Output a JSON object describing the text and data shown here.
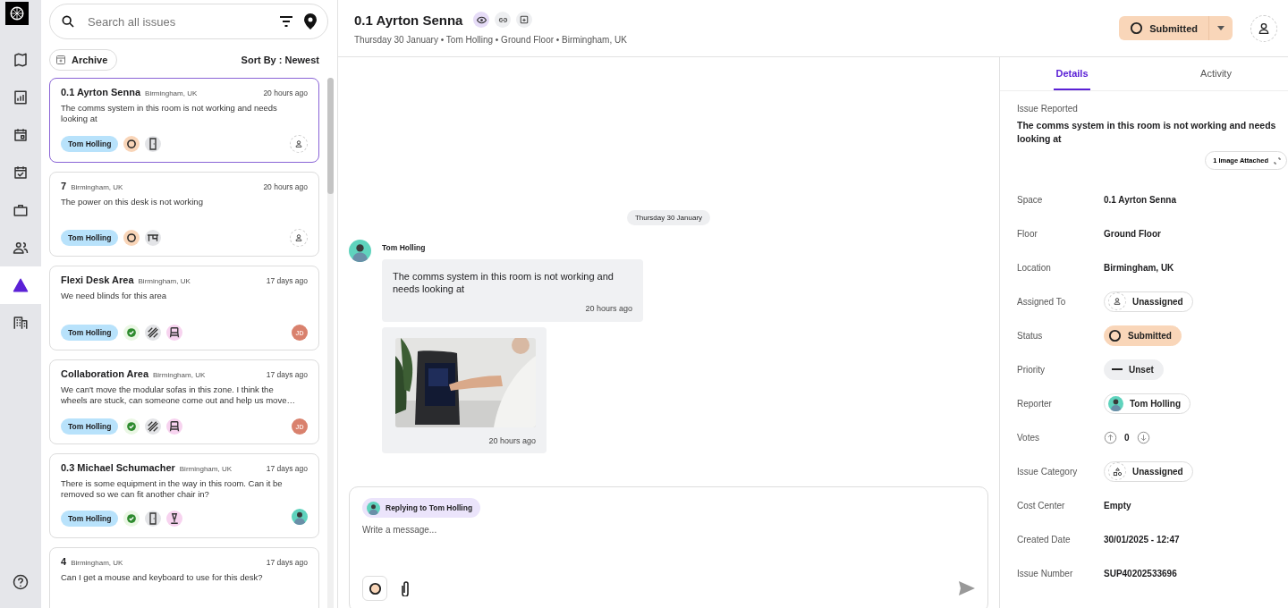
{
  "rail": {
    "items": [
      {
        "kind": "map",
        "selected": false
      },
      {
        "kind": "chart",
        "selected": false
      },
      {
        "kind": "calendar",
        "selected": false
      },
      {
        "kind": "calendar-check",
        "selected": false
      },
      {
        "kind": "briefcase",
        "selected": false
      },
      {
        "kind": "people",
        "selected": false
      },
      {
        "kind": "warning",
        "selected": true
      },
      {
        "kind": "building",
        "selected": false
      }
    ]
  },
  "search": {
    "placeholder": "Search all issues"
  },
  "archive_button": "Archive",
  "sort": "Sort By : Newest",
  "issues": [
    {
      "title": "0.1 Ayrton Senna",
      "location": "Birmingham, UK",
      "time": "20 hours ago",
      "description": "The comms system in this room is not working and needs looking at",
      "reporter": "Tom Holling",
      "status": {
        "kind": "submitted"
      },
      "categories": [
        {
          "kind": "door"
        }
      ],
      "assignee": {
        "kind": "unassigned"
      },
      "selected": true
    },
    {
      "title": "7",
      "location": "Birmingham, UK",
      "time": "20 hours ago",
      "description": "The power on this desk is not working",
      "reporter": "Tom Holling",
      "status": {
        "kind": "submitted"
      },
      "categories": [
        {
          "kind": "desk"
        }
      ],
      "assignee": {
        "kind": "unassigned"
      },
      "selected": false
    },
    {
      "title": "Flexi Desk Area",
      "location": "Birmingham, UK",
      "time": "17 days ago",
      "description": "We need blinds for this area",
      "reporter": "Tom Holling",
      "status": {
        "kind": "resolved"
      },
      "categories": [
        {
          "kind": "hatch"
        },
        {
          "kind": "chair"
        }
      ],
      "assignee": {
        "kind": "initials",
        "text": "JD"
      },
      "selected": false
    },
    {
      "title": "Collaboration Area",
      "location": "Birmingham, UK",
      "time": "17 days ago",
      "description": "We can't move the modular sofas in this zone. I think the wheels are stuck, can someone come out and help us move…",
      "reporter": "Tom Holling",
      "status": {
        "kind": "resolved"
      },
      "categories": [
        {
          "kind": "hatch"
        },
        {
          "kind": "chair"
        }
      ],
      "assignee": {
        "kind": "initials",
        "text": "JD"
      },
      "selected": false
    },
    {
      "title": "0.3 Michael Schumacher",
      "location": "Birmingham, UK",
      "time": "17 days ago",
      "description": "There is some equipment in the way in this room. Can it be removed so we can fit another chair in?",
      "reporter": "Tom Holling",
      "status": {
        "kind": "resolved"
      },
      "categories": [
        {
          "kind": "door"
        },
        {
          "kind": "lamp"
        }
      ],
      "assignee": {
        "kind": "avatar"
      },
      "selected": false
    },
    {
      "title": "4",
      "location": "Birmingham, UK",
      "time": "17 days ago",
      "description": "Can I get a mouse and keyboard to use for this desk?",
      "selected": false
    }
  ],
  "header": {
    "title": "0.1 Ayrton Senna",
    "subtitle": "Thursday 30 January • Tom Holling • Ground Floor • Birmingham, UK",
    "status_button": "Submitted"
  },
  "chat": {
    "date": "Thursday 30 January",
    "author": "Tom Holling",
    "messages": [
      {
        "kind": "text",
        "text": "The comms system in this room is not working and needs looking at",
        "time": "20 hours ago"
      },
      {
        "time": "20 hours ago"
      }
    ]
  },
  "composer": {
    "reply_to": "Replying to Tom Holling",
    "placeholder": "Write a message..."
  },
  "details": {
    "tabs": [
      {
        "label": "Details",
        "selected": true
      },
      {
        "label": "Activity",
        "selected": false
      }
    ],
    "issue_label": "Issue Reported",
    "issue_text": "The comms system in this room is not working and needs looking at",
    "attachment": "1 Image Attached",
    "fields": [
      {
        "label": "Space",
        "kind": "text",
        "value": "0.1 Ayrton Senna"
      },
      {
        "label": "Floor",
        "kind": "text",
        "value": "Ground Floor"
      },
      {
        "label": "Location",
        "kind": "text",
        "value": "Birmingham, UK"
      },
      {
        "label": "Assigned To",
        "kind": "user",
        "value": "Unassigned"
      },
      {
        "label": "Status",
        "kind": "status",
        "value": "Submitted"
      },
      {
        "label": "Priority",
        "kind": "priority",
        "value": "Unset"
      },
      {
        "label": "Reporter",
        "kind": "reporter",
        "value": "Tom Holling"
      },
      {
        "label": "Votes",
        "kind": "votes",
        "value": "0"
      },
      {
        "label": "Issue Category",
        "kind": "category",
        "value": "Unassigned"
      },
      {
        "label": "Cost Center",
        "kind": "text",
        "value": "Empty"
      },
      {
        "label": "Created Date",
        "kind": "text",
        "value": "30/01/2025 - 12:47"
      },
      {
        "label": "Issue Number",
        "kind": "text",
        "value": "SUP40202533696"
      }
    ]
  }
}
